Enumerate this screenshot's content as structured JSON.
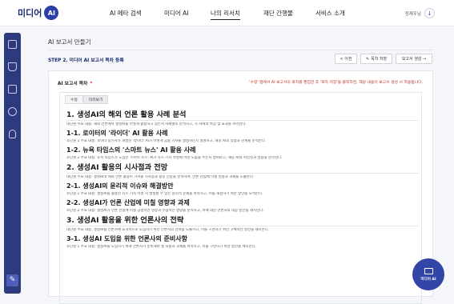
{
  "header": {
    "logo_text": "미디어",
    "logo_badge": "AI",
    "nav": [
      "AI 메타 검색",
      "미디어 AI",
      "나의 리서치",
      "재단 간행물",
      "서비스 소개"
    ],
    "active_nav": "나의 리서치",
    "user_name": "정재우님"
  },
  "page": {
    "title": "AI 보고서 만들기",
    "step": "STEP 2.  미디어 AI 보고서 목차 등록",
    "buttons": {
      "prev": "< 이전",
      "save": "목차 저장",
      "generate": "보고서 생성 →"
    }
  },
  "panel": {
    "label": "AI 보고서 목차",
    "required": "*",
    "hint": "'수정' 탭에서 AI 보고서의 목차를 편집한 후 '목차 저장'을 클릭하면, 해당 내용이 보고서 생성 시 적용됩니다.",
    "tabs": [
      "수정",
      "미리보기"
    ]
  },
  "doc": [
    {
      "type": "h1",
      "text": "1. 생성AI의 해외 언론 활용 사례 분석"
    },
    {
      "type": "p",
      "text": "대단원 주요 내용: 해외 언론에서 생성AI를 어떻게 활용하고 있는지 사례별로 분석하고, 각 사례의 특징 및 효과를 파악한다."
    },
    {
      "type": "h2",
      "text": "1-1. 로이터의 '라이더' AI 활용 사례"
    },
    {
      "type": "p",
      "text": "소단원 1 주요 내용: 로이터 통신사가 개발한 '라이더' AI가 어떻게 금융 기사를 생성하는지 설명하고, 해당 AI의 장점과 한계를 분석한다."
    },
    {
      "type": "h2",
      "text": "1-2. 뉴욕 타임스의 '스마트 뉴스' AI 활용 사례"
    },
    {
      "type": "p",
      "text": "소단원 2 주요 내용: 뉴욕 타임스가 도입한 '스마트 뉴스' AI가 뉴스 기사 작성에 어떤 도움을 주는지 살펴보고, 해당 AI의 혁신성과 영향을 분석한다."
    },
    {
      "type": "h1",
      "text": "2. 생성AI 활용의 시사점과 전망"
    },
    {
      "type": "p",
      "text": "대단원 주요 내용: 생성AI의 해외 언론 활용이 가져올 시사점과 향후 전망을 분석하여, 언론 산업에 미칠 영향과 과제를 도출한다."
    },
    {
      "type": "h2",
      "text": "2-1. 생성AI의 윤리적 이슈와 해결방안"
    },
    {
      "type": "p",
      "text": "소단원 1 주요 내용: 생성AI를 활용한 뉴스 기사 작성 시 발생할 수 있는 윤리적 문제를 파악하고, 이를 해결하기 위한 방안을 모색한다."
    },
    {
      "type": "h2",
      "text": "2-2. 생성AI가 언론 산업에 미칠 영향과 과제"
    },
    {
      "type": "p",
      "text": "소단원 2 주요 내용: 생성AI가 언론 산업에 미칠 긍정적인 영향과 부정적인 영향을 분석하고, 이에 대한 언론사의 대응 방안을 제시한다."
    },
    {
      "type": "h1",
      "text": "3. 생성AI 활용을 위한 언론사의 전략"
    },
    {
      "type": "p",
      "text": "대단원 주요 내용: 생성AI를 언론사에 효과적으로 도입하기 위한 언론사의 전략을 도출하고, 이를 구현하기 위한 구체적인 방안을 제시한다."
    },
    {
      "type": "h2",
      "text": "3-1. 생성AI 도입을 위한 언론사의 준비사항"
    },
    {
      "type": "p",
      "text": "소단원 1 주요 내용: 생성AI를 도입하기 위해 언론사가 준비해야 할 사항과 과제를 파악하고, 이를 구현하기 위한 방안을 제시한다."
    }
  ],
  "fab": {
    "label": "미디어 AI"
  }
}
